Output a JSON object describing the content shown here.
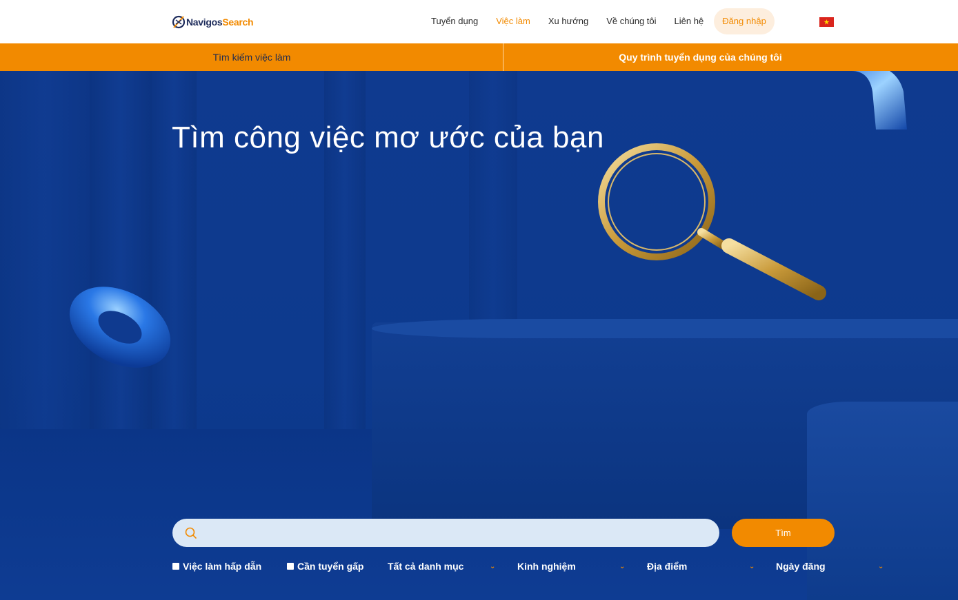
{
  "header": {
    "logo": {
      "part1": "Navigos",
      "part2": "earch",
      "prefix": "S"
    },
    "nav": [
      {
        "label": "Tuyển dụng",
        "active": false
      },
      {
        "label": "Việc làm",
        "active": true
      },
      {
        "label": "Xu hướng",
        "active": false
      },
      {
        "label": "Về chúng tôi",
        "active": false
      },
      {
        "label": "Liên hệ",
        "active": false
      }
    ],
    "login_label": "Đăng nhập",
    "language_flag": "vietnam-flag-icon"
  },
  "subbar": {
    "left_label": "Tìm kiếm việc làm",
    "right_label": "Quy trình tuyển dụng của chúng tôi"
  },
  "hero": {
    "title": "Tìm công việc mơ ước của bạn"
  },
  "search": {
    "placeholder": "",
    "value": "",
    "button_label": "Tìm"
  },
  "filters": {
    "checkbox_1": "Việc làm hấp dẫn",
    "checkbox_2": "Cần tuyển gấp",
    "dropdown_category": "Tất cả danh mục",
    "dropdown_experience": "Kinh nghiệm",
    "dropdown_location": "Địa điểm",
    "dropdown_date": "Ngày đăng"
  },
  "colors": {
    "accent": "#f28a00",
    "hero_blue": "#0f3a8f",
    "navy": "#1d2b5b"
  }
}
